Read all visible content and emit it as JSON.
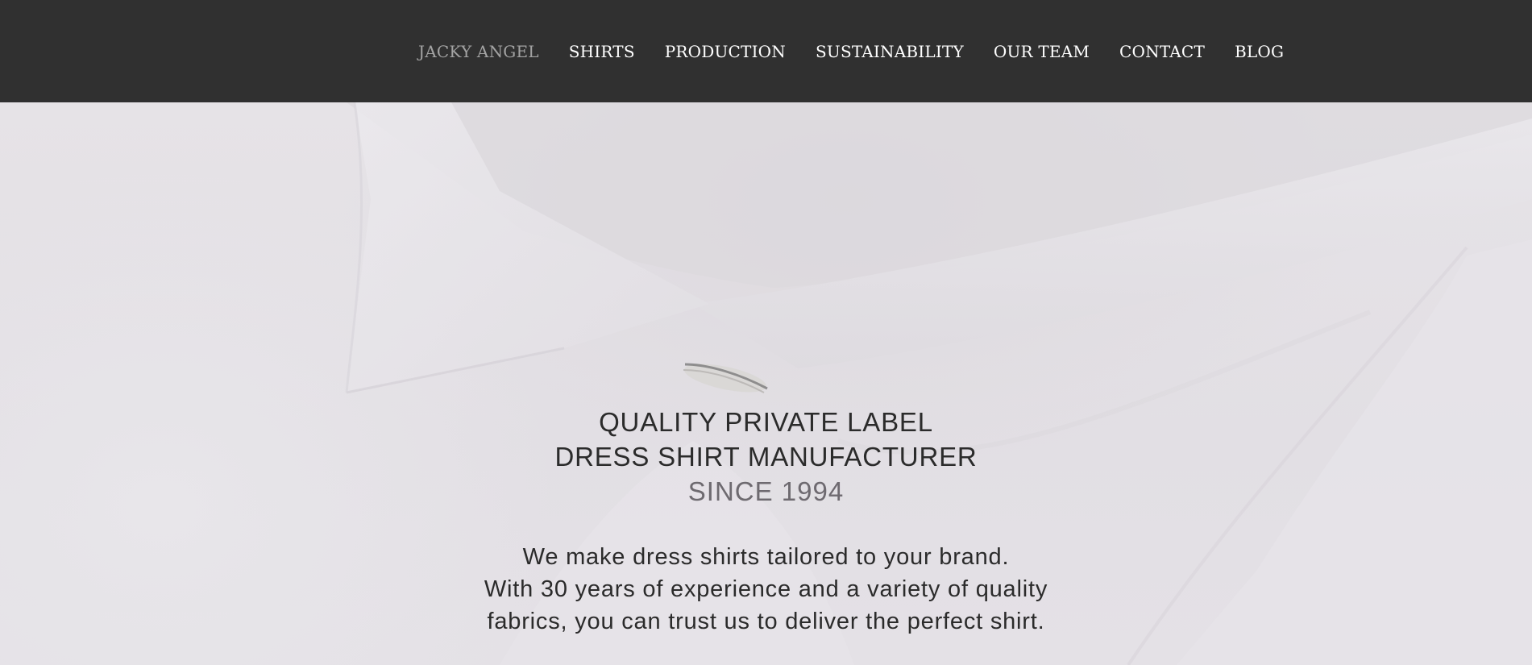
{
  "nav": {
    "brand": "JACKY ANGEL",
    "items": [
      {
        "label": "SHIRTS"
      },
      {
        "label": "PRODUCTION"
      },
      {
        "label": "SUSTAINABILITY"
      },
      {
        "label": "OUR TEAM"
      },
      {
        "label": "CONTACT"
      },
      {
        "label": "BLOG"
      }
    ]
  },
  "hero": {
    "headline_line1": "QUALITY PRIVATE LABEL",
    "headline_line2": "DRESS SHIRT MANUFACTURER",
    "headline_line3": "SINCE 1994",
    "body_line1": "We make dress shirts tailored to your brand.",
    "body_line2": "With 30 years of experience and a variety of quality",
    "body_line3": "fabrics, you can trust us to deliver the perfect shirt."
  },
  "colors": {
    "nav_background": "#303030",
    "nav_text": "#ffffff",
    "brand_text": "#a3a3a3",
    "hero_background": "#e4e1e6",
    "headline_text": "#2b2b2b",
    "since_text": "#6e6a70"
  }
}
